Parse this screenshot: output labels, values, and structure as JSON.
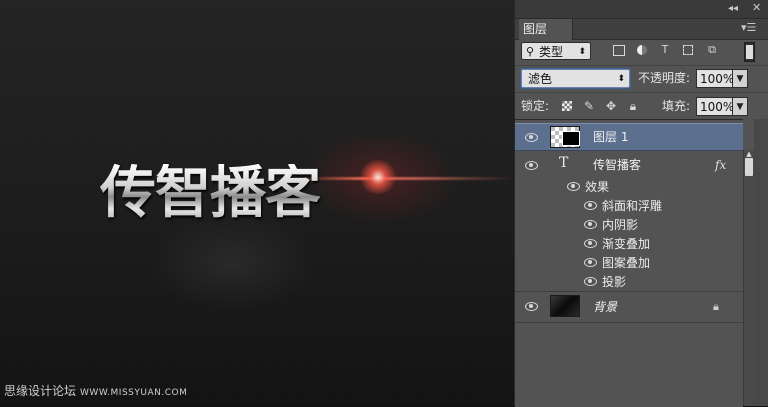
{
  "canvas": {
    "title_text": "传智播客",
    "watermark": "思缘设计论坛",
    "watermark_url": "WWW.MISSYUAN.COM"
  },
  "panel": {
    "collapse_icon": "double-chevron-left-icon",
    "close_icon": "close-icon",
    "tab_label": "图层",
    "menu_icon": "panel-menu-icon",
    "filter": {
      "kind_label": "类型",
      "icons": [
        "image-filter-icon",
        "adjustment-filter-icon",
        "type-filter-icon",
        "shape-filter-icon",
        "smart-object-filter-icon"
      ]
    },
    "blend_mode": "滤色",
    "opacity_label": "不透明度:",
    "opacity_value": "100%",
    "lock_label": "锁定:",
    "fill_label": "填充:",
    "fill_value": "100%",
    "layers": [
      {
        "name": "图层 1",
        "selected": true
      },
      {
        "name": "传智播客",
        "type": "text",
        "has_fx": true,
        "fx_label": "fx",
        "effects_label": "效果",
        "effects": [
          "斜面和浮雕",
          "内阴影",
          "渐变叠加",
          "图案叠加",
          "投影"
        ]
      },
      {
        "name": "背景",
        "locked": true
      }
    ]
  },
  "colors": {
    "panel_bg": "#535353",
    "selected_layer": "#5d6f8e",
    "flare": "#ff5a46"
  }
}
